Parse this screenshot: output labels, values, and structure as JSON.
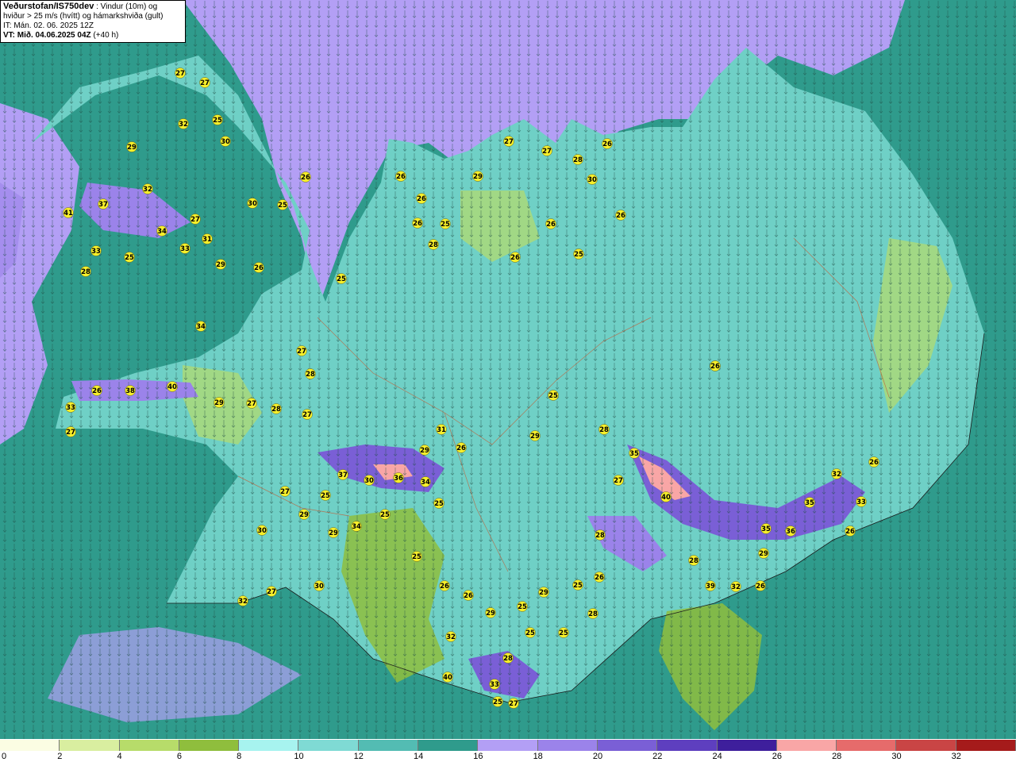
{
  "header": {
    "title": "Veðurstofan/IS750dev",
    "desc_line1": " : Vindur (10m) og",
    "desc_line2": "hviður > 25 m/s (hvítt) og hámarkshviða (gult)",
    "init_time": "IT: Mán. 02. 06. 2025 12Z",
    "valid_label": "VT: Mið. 04.06.2025 04Z",
    "lead": " (+40 h)"
  },
  "colorbar": {
    "colors": [
      "#fbfde3",
      "#d9eea0",
      "#b7dc6a",
      "#8fbe3d",
      "#a7f3ef",
      "#7fdad4",
      "#53bcb3",
      "#2f9b8c",
      "#b39ff5",
      "#9b83ea",
      "#7a5fd6",
      "#5e3fbf",
      "#3e1f9c",
      "#f9a6a6",
      "#e66b6b",
      "#c94545",
      "#a51b1b",
      "#f0b429"
    ],
    "ticks": [
      "0",
      "2",
      "4",
      "6",
      "8",
      "10",
      "12",
      "14",
      "16",
      "18",
      "20",
      "22",
      "24",
      "26",
      "28",
      "30",
      "32"
    ]
  },
  "gust_labels": [
    "27",
    "27",
    "25",
    "32",
    "30",
    "29",
    "32",
    "26",
    "37",
    "41",
    "27",
    "34",
    "31",
    "30",
    "33",
    "25",
    "25",
    "33",
    "28",
    "29",
    "26",
    "34",
    "27",
    "28",
    "26",
    "38",
    "40",
    "29",
    "27",
    "28",
    "27",
    "33",
    "27",
    "26",
    "26",
    "25",
    "28",
    "25",
    "26",
    "27",
    "29",
    "27",
    "26",
    "26",
    "28",
    "30",
    "25",
    "26",
    "26",
    "31",
    "29",
    "26",
    "25",
    "29",
    "37",
    "30",
    "36",
    "34",
    "28",
    "35",
    "26",
    "27",
    "40",
    "25",
    "25",
    "35",
    "36",
    "35",
    "33",
    "32",
    "26",
    "29",
    "28",
    "27",
    "29",
    "25",
    "29",
    "30",
    "34",
    "25",
    "26",
    "32",
    "39",
    "32",
    "26",
    "26",
    "29",
    "25",
    "26",
    "25",
    "25",
    "28",
    "29",
    "32",
    "30",
    "27",
    "32",
    "28",
    "40",
    "33",
    "25",
    "27",
    "25",
    "26",
    "28"
  ]
}
